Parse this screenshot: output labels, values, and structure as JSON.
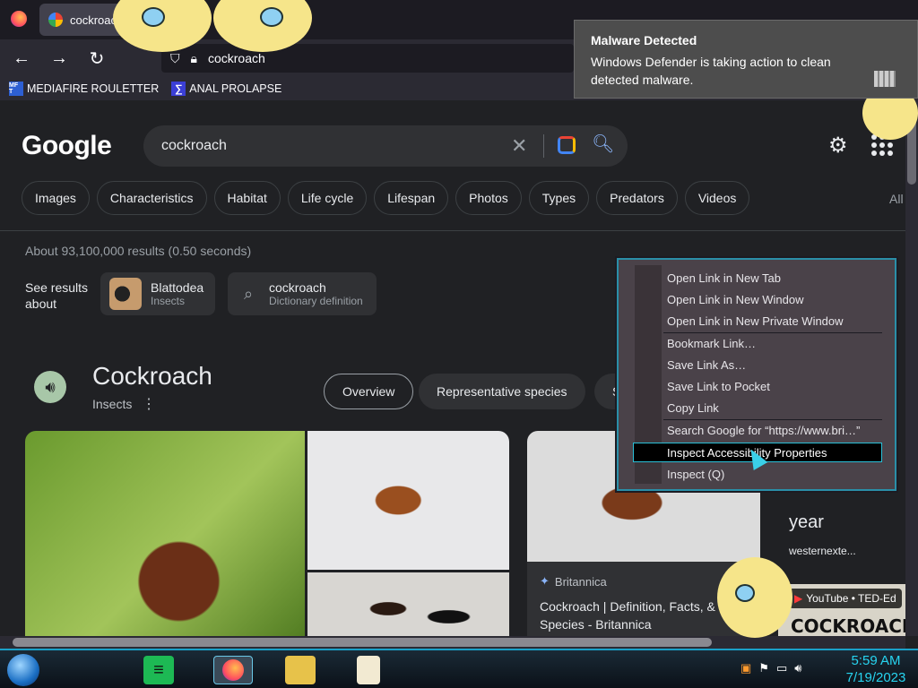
{
  "browser": {
    "tab_title": "cockroac",
    "url": "cockroach",
    "bookmarks": [
      {
        "icon": "MF T",
        "label": "MEDIAFIRE ROULETTER"
      },
      {
        "icon": "sigma-icon",
        "label": "ANAL PROLAPSE"
      }
    ]
  },
  "google": {
    "logo": "Google",
    "query": "cockroach",
    "chips": [
      "Images",
      "Characteristics",
      "Habitat",
      "Life cycle",
      "Lifespan",
      "Photos",
      "Types",
      "Predators",
      "Videos"
    ],
    "all_label": "All",
    "stats": "About 93,100,000 results (0.50 seconds)",
    "see_results_about": "See results about",
    "about_cards": [
      {
        "title": "Blattodea",
        "sub": "Insects"
      },
      {
        "title": "cockroach",
        "sub": "Dictionary definition"
      }
    ],
    "kp_title": "Cockroach",
    "kp_sub": "Insects",
    "kp_tabs": [
      "Overview",
      "Representative species",
      "S"
    ],
    "card": {
      "source": "Britannica",
      "text": "Cockroach | Definition, Facts, & Species - Britannica"
    },
    "card2": {
      "text": "year",
      "source": "westernexte..."
    },
    "yt_badge": "YouTube • TED-Ed",
    "yt_thumb_text": "COCKROACH"
  },
  "context_menu": {
    "items": [
      "Open Link in New Tab",
      "Open Link in New Window",
      "Open Link in New Private Window",
      "Bookmark Link…",
      "Save Link As…",
      "Save Link to Pocket",
      "Copy Link",
      "Search Google for “https://www.bri…”",
      "Inspect Accessibility Properties",
      "Inspect (Q)"
    ],
    "selected_index": 8
  },
  "notification": {
    "title": "Malware Detected",
    "body": "Windows Defender is taking action to clean detected malware."
  },
  "taskbar": {
    "time": "5:59 AM",
    "date": "7/19/2023"
  },
  "colors": {
    "accent": "#27d4f0",
    "search_blue": "#8ab4f8"
  }
}
